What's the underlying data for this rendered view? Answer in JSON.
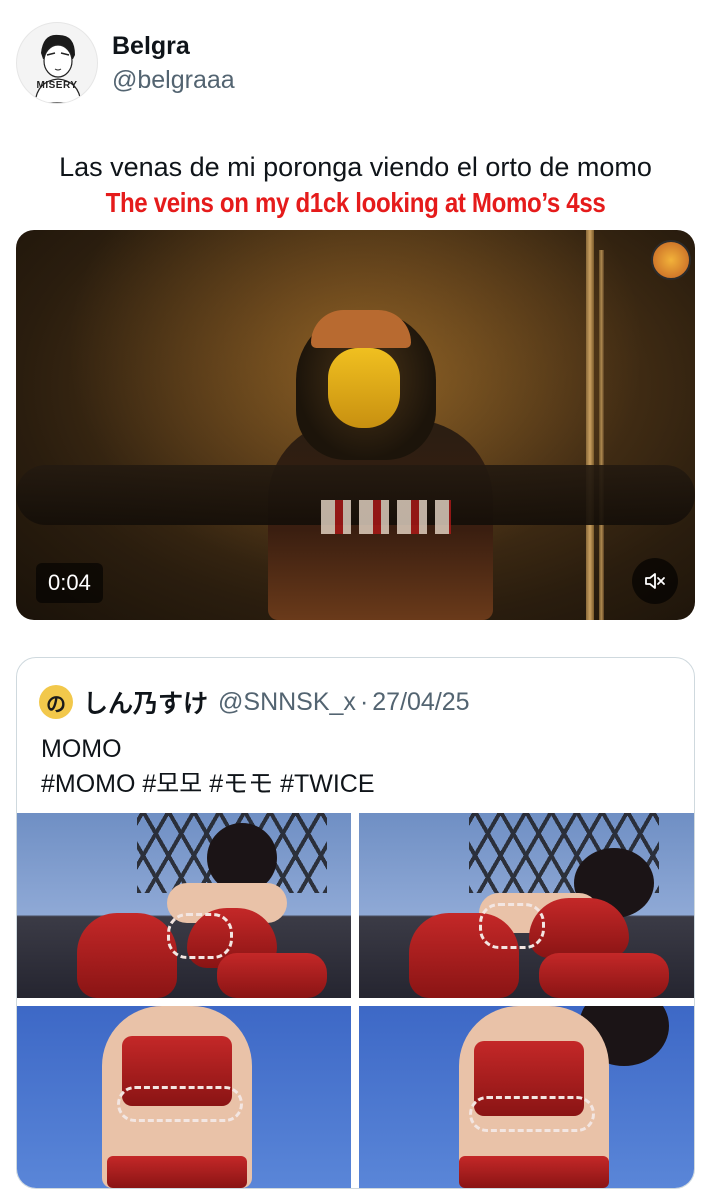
{
  "author": {
    "display_name": "Belgra",
    "handle": "@belgraaa",
    "avatar_text": "MISERY"
  },
  "tweet": {
    "text": "Las venas de mi poronga viendo el orto de momo",
    "translation": "The veins on my d1ck looking at Momo’s 4ss"
  },
  "video": {
    "timestamp": "0:04",
    "mute_icon": "speaker-muted-icon",
    "badge_icon": "channel-badge-icon"
  },
  "quoted_tweet": {
    "avatar_glyph": "の",
    "display_name": "しん乃すけ",
    "handle": "@SNNSK_x",
    "separator": "·",
    "date": "27/04/25",
    "line1": "MOMO",
    "line2": "#MOMO #모모 #モモ #TWICE",
    "photos": [
      "photo-1",
      "photo-2",
      "photo-3",
      "photo-4"
    ]
  },
  "colors": {
    "translation_red": "#e51b1b",
    "secondary_text": "#536471",
    "border": "#cfd9de"
  }
}
